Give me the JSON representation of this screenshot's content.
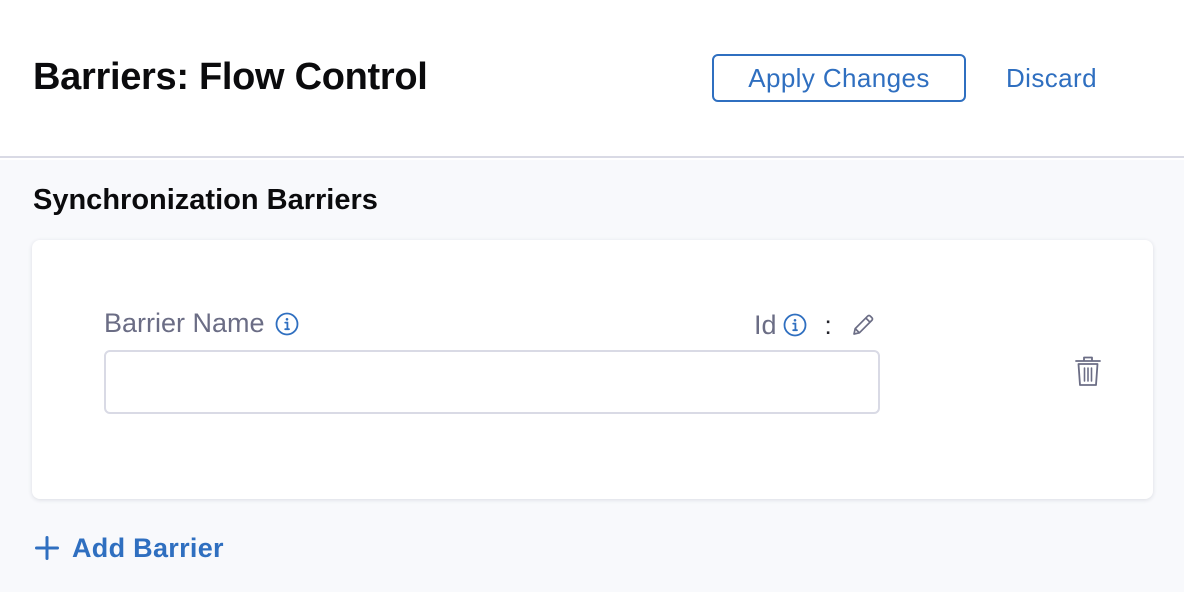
{
  "header": {
    "title": "Barriers: Flow Control",
    "apply_label": "Apply Changes",
    "discard_label": "Discard"
  },
  "section": {
    "title": "Synchronization Barriers"
  },
  "barrier_card": {
    "name_label": "Barrier Name",
    "id_label": "Id",
    "id_separator": ":",
    "name_value": "",
    "name_placeholder": ""
  },
  "add_barrier_label": "Add Barrier",
  "icons": {
    "info": "info-icon",
    "edit": "pencil-icon",
    "delete": "trash-icon",
    "add": "plus-icon"
  },
  "colors": {
    "accent": "#2f6fc0",
    "label": "#6b6d85",
    "border": "#d9dae5",
    "background": "#f8f9fc"
  }
}
